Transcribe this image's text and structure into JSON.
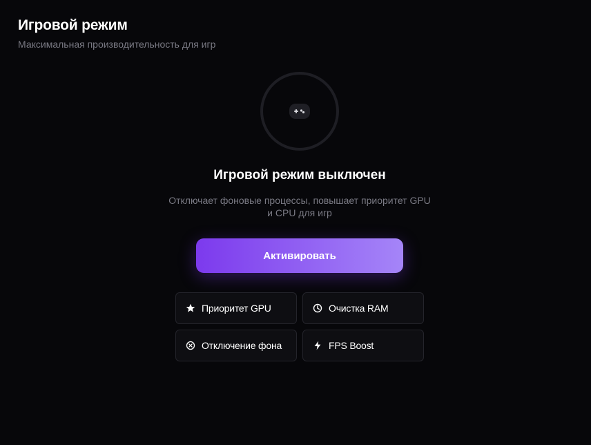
{
  "header": {
    "title": "Игровой режим",
    "subtitle": "Максимальная производительность для игр"
  },
  "status": {
    "icon": "gamepad-icon",
    "title": "Игровой режим выключен",
    "description": "Отключает фоновые процессы, повышает приоритет GPU и CPU для игр"
  },
  "actions": {
    "activate_label": "Активировать"
  },
  "features": [
    {
      "icon": "star-icon",
      "label": "Приоритет GPU"
    },
    {
      "icon": "clock-icon",
      "label": "Очистка RAM"
    },
    {
      "icon": "close-circle-icon",
      "label": "Отключение фона"
    },
    {
      "icon": "lightning-icon",
      "label": "FPS Boost"
    }
  ],
  "colors": {
    "background": "#07070a",
    "accent_start": "#7c3aed",
    "accent_end": "#a585f8",
    "muted_text": "#7a7a84",
    "card_border": "#24242b"
  }
}
